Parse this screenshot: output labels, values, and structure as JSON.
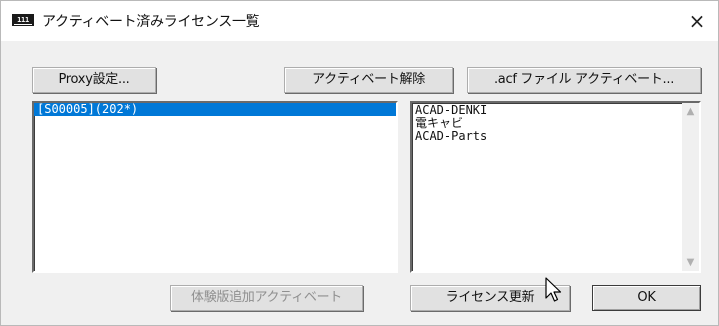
{
  "window": {
    "title": "アクティベート済みライセンス一覧",
    "app_icon_text": "ℍℍ"
  },
  "toolbar": {
    "proxy_button": "Proxy設定...",
    "deactivate_button": "アクティベート解除",
    "acf_button": ".acf ファイル アクティベート..."
  },
  "license_list": {
    "items": [
      "[S00005](202*)"
    ],
    "selected_index": 0
  },
  "product_list": {
    "items": [
      "ACAD-DENKI",
      "電キャビ",
      "ACAD-Parts"
    ]
  },
  "footer": {
    "trial_button": "体験版追加アクティベート",
    "renew_button": "ライセンス更新",
    "ok_button": "OK"
  },
  "icons": {
    "close": "×",
    "scroll_up": "▲",
    "scroll_down": "▼"
  }
}
